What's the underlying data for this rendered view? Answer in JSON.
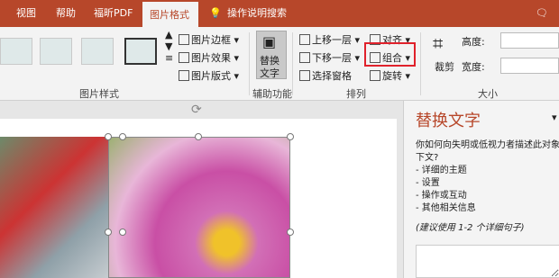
{
  "tabs": {
    "view": "视图",
    "help": "帮助",
    "pdf": "福昕PDF",
    "format": "图片格式",
    "tellme": "操作说明搜索"
  },
  "style_group": {
    "border": "图片边框",
    "effects": "图片效果",
    "layout": "图片版式",
    "label": "图片样式"
  },
  "access": {
    "alt_btn_line1": "替换",
    "alt_btn_line2": "文字",
    "label": "辅助功能"
  },
  "arrange": {
    "forward": "上移一层",
    "backward": "下移一层",
    "pane": "选择窗格",
    "align": "对齐",
    "group": "组合",
    "rotate": "旋转",
    "label": "排列"
  },
  "size": {
    "crop": "裁剪",
    "height_label": "高度:",
    "width_label": "宽度:",
    "label": "大小"
  },
  "alt_pane": {
    "title": "替换文字",
    "desc_line1": "你如何向失明或低视力者描述此对象",
    "desc_line2": "下文?",
    "items": [
      "- 详细的主题",
      "- 设置",
      "- 操作或互动",
      "- 其他相关信息"
    ],
    "hint": "(建议使用 1-2 个详细句子)"
  }
}
